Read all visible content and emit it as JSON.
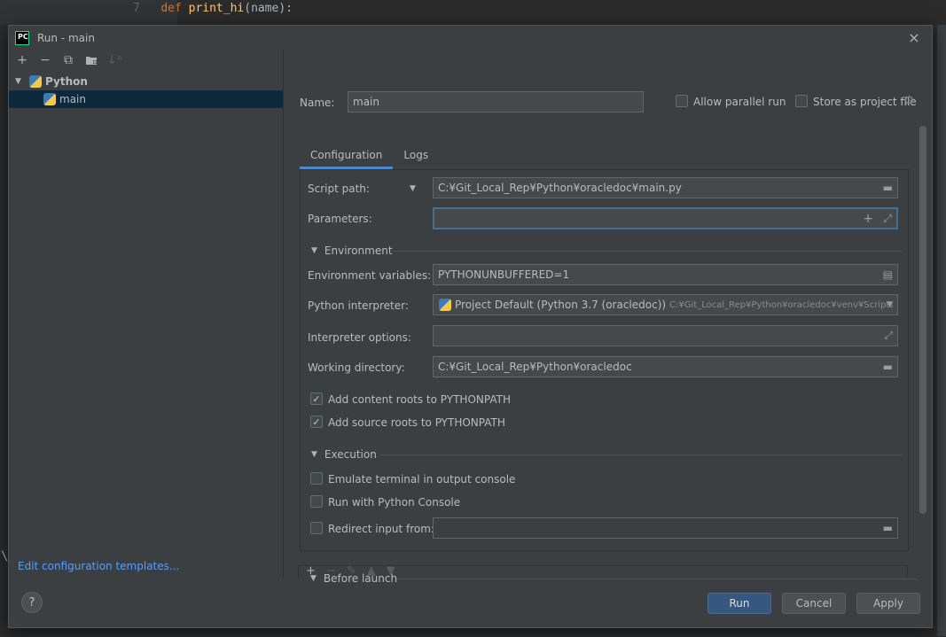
{
  "editor": {
    "line_number": "7",
    "code_keyword": "def",
    "code_function": "print_hi",
    "code_rest": "(name):"
  },
  "stray_char": "\\",
  "window": {
    "title": "Run - main",
    "logo_text": "PC",
    "close_icon": "×"
  },
  "left_toolbar": {
    "add_icon": "+",
    "remove_icon": "−",
    "copy_icon": "⧉",
    "folder_icon": "▪",
    "sort_icon": "↓ᵃ"
  },
  "tree": {
    "group_label": "Python",
    "item_label": "main",
    "arrow": "▼"
  },
  "templates_link": "Edit configuration templates...",
  "form": {
    "name_label": "Name:",
    "name_value": "main",
    "allow_parallel_label": "Allow parallel run",
    "store_as_project_label": "Store as project file",
    "tabs": [
      "Configuration",
      "Logs"
    ],
    "script_path_label": "Script path:",
    "script_path_value": "C:¥Git_Local_Rep¥Python¥oracledoc¥main.py",
    "parameters_label": "Parameters:",
    "parameters_value": "",
    "environment_section": "Environment",
    "env_vars_label": "Environment variables:",
    "env_vars_value": "PYTHONUNBUFFERED=1",
    "interpreter_label": "Python interpreter:",
    "interpreter_value": "Project Default (Python 3.7 (oracledoc))",
    "interpreter_path": "C:¥Git_Local_Rep¥Python¥oracledoc¥venv¥Scripts¥pytl",
    "interpreter_options_label": "Interpreter options:",
    "working_dir_label": "Working directory:",
    "working_dir_value": "C:¥Git_Local_Rep¥Python¥oracledoc",
    "content_roots_label": "Add content roots to PYTHONPATH",
    "content_roots_checked": true,
    "source_roots_label": "Add source roots to PYTHONPATH",
    "source_roots_checked": true,
    "execution_section": "Execution",
    "emulate_terminal_label": "Emulate terminal in output console",
    "python_console_label": "Run with Python Console",
    "redirect_input_label": "Redirect input from:",
    "before_launch_section": "Before launch",
    "check_mark": "✓"
  },
  "buttons": {
    "help": "?",
    "run": "Run",
    "cancel": "Cancel",
    "apply": "Apply"
  },
  "colors": {
    "accent": "#4a88c7",
    "link": "#589df6",
    "primary_button": "#365880",
    "selection": "#0d293e"
  }
}
